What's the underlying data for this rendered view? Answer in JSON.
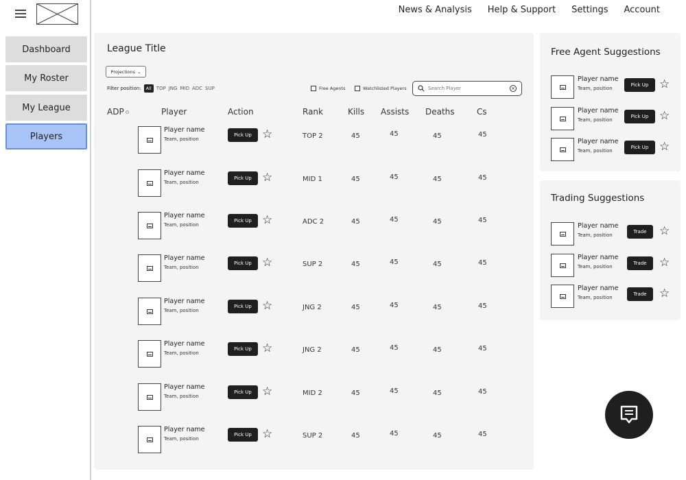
{
  "nav": {
    "top_links": [
      "News & Analysis",
      "Help & Support",
      "Settings",
      "Account"
    ],
    "sidebar": [
      "Dashboard",
      "My Roster",
      "My League",
      "Players"
    ],
    "active": "Players"
  },
  "main": {
    "title": "League Title",
    "projections_label": "Projections",
    "filter_label": "Filter position:",
    "positions": [
      "All",
      "TOP",
      "JNG",
      "MID",
      "ADC",
      "SUP"
    ],
    "free_agents_label": "Free Agents",
    "watchlisted_label": "Watchlisted Players",
    "search_placeholder": "Search Player",
    "columns": {
      "adp": "ADP",
      "player": "Player",
      "action": "Action",
      "rank": "Rank",
      "kills": "Kills",
      "assists": "Assists",
      "deaths": "Deaths",
      "cs": "Cs"
    },
    "rows": [
      {
        "name": "Player name",
        "team": "Team, position",
        "action": "Pick Up",
        "rank": "TOP 2",
        "kills": "45",
        "assists": "45",
        "deaths": "45",
        "cs": "45"
      },
      {
        "name": "Player name",
        "team": "Team, position",
        "action": "Pick Up",
        "rank": "MID 1",
        "kills": "45",
        "assists": "45",
        "deaths": "45",
        "cs": "45"
      },
      {
        "name": "Player name",
        "team": "Team, position",
        "action": "Pick Up",
        "rank": "ADC 2",
        "kills": "45",
        "assists": "45",
        "deaths": "45",
        "cs": "45"
      },
      {
        "name": "Player name",
        "team": "Team, position",
        "action": "Pick Up",
        "rank": "SUP 2",
        "kills": "45",
        "assists": "45",
        "deaths": "45",
        "cs": "45"
      },
      {
        "name": "Player name",
        "team": "Team, position",
        "action": "Pick Up",
        "rank": "JNG 2",
        "kills": "45",
        "assists": "45",
        "deaths": "45",
        "cs": "45"
      },
      {
        "name": "Player name",
        "team": "Team, position",
        "action": "Pick Up",
        "rank": "JNG 2",
        "kills": "45",
        "assists": "45",
        "deaths": "45",
        "cs": "45"
      },
      {
        "name": "Player name",
        "team": "Team, position",
        "action": "Pick Up",
        "rank": "MID 2",
        "kills": "45",
        "assists": "45",
        "deaths": "45",
        "cs": "45"
      },
      {
        "name": "Player name",
        "team": "Team, position",
        "action": "Pick Up",
        "rank": "SUP 2",
        "kills": "45",
        "assists": "45",
        "deaths": "45",
        "cs": "45"
      }
    ]
  },
  "free_agents": {
    "title": "Free Agent Suggestions",
    "items": [
      {
        "name": "Player name",
        "team": "Team, position",
        "action": "Pick Up"
      },
      {
        "name": "Player name",
        "team": "Team, position",
        "action": "Pick Up"
      },
      {
        "name": "Player name",
        "team": "Team, position",
        "action": "Pick Up"
      }
    ]
  },
  "trading": {
    "title": "Trading Suggestions",
    "items": [
      {
        "name": "Player name",
        "team": "Team, position",
        "action": "Trade"
      },
      {
        "name": "Player name",
        "team": "Team, position",
        "action": "Trade"
      },
      {
        "name": "Player name",
        "team": "Team, position",
        "action": "Trade"
      }
    ]
  },
  "icons": {
    "menu": "hamburger-menu-icon",
    "logo": "logo-placeholder",
    "search": "search-icon",
    "clear": "clear-icon",
    "star": "star-icon",
    "image": "image-placeholder-icon",
    "chat": "chat-icon"
  },
  "colors": {
    "active_nav": "#a9c5f7",
    "button_dark": "#1f1f1f",
    "panel_bg": "#f4f4f4"
  }
}
